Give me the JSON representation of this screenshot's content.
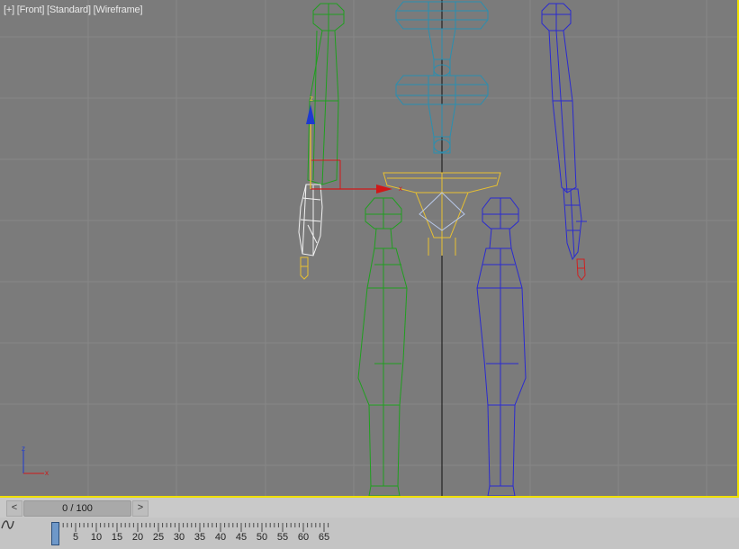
{
  "viewport": {
    "label": {
      "menu": "[+]",
      "view": "[Front]",
      "shading_preset": "[Standard]",
      "shading_mode": "[Wireframe]"
    },
    "active_border_color": "#f0e000",
    "background_color": "#7b7b7b",
    "gizmo": {
      "axis_x": "x",
      "axis_z": "z"
    },
    "axis_tripod": {
      "axis_x": "x",
      "axis_z": "z"
    }
  },
  "timeline": {
    "prev_label": "<",
    "next_label": ">",
    "slider_text": "0 / 100",
    "current_frame": 0,
    "total_frames": 100,
    "tick_labels": [
      "0",
      "5",
      "10",
      "15",
      "20",
      "25",
      "30",
      "35",
      "40",
      "45",
      "50",
      "55",
      "60",
      "65"
    ],
    "curve_icon": "mini-curve-editor-icon"
  }
}
